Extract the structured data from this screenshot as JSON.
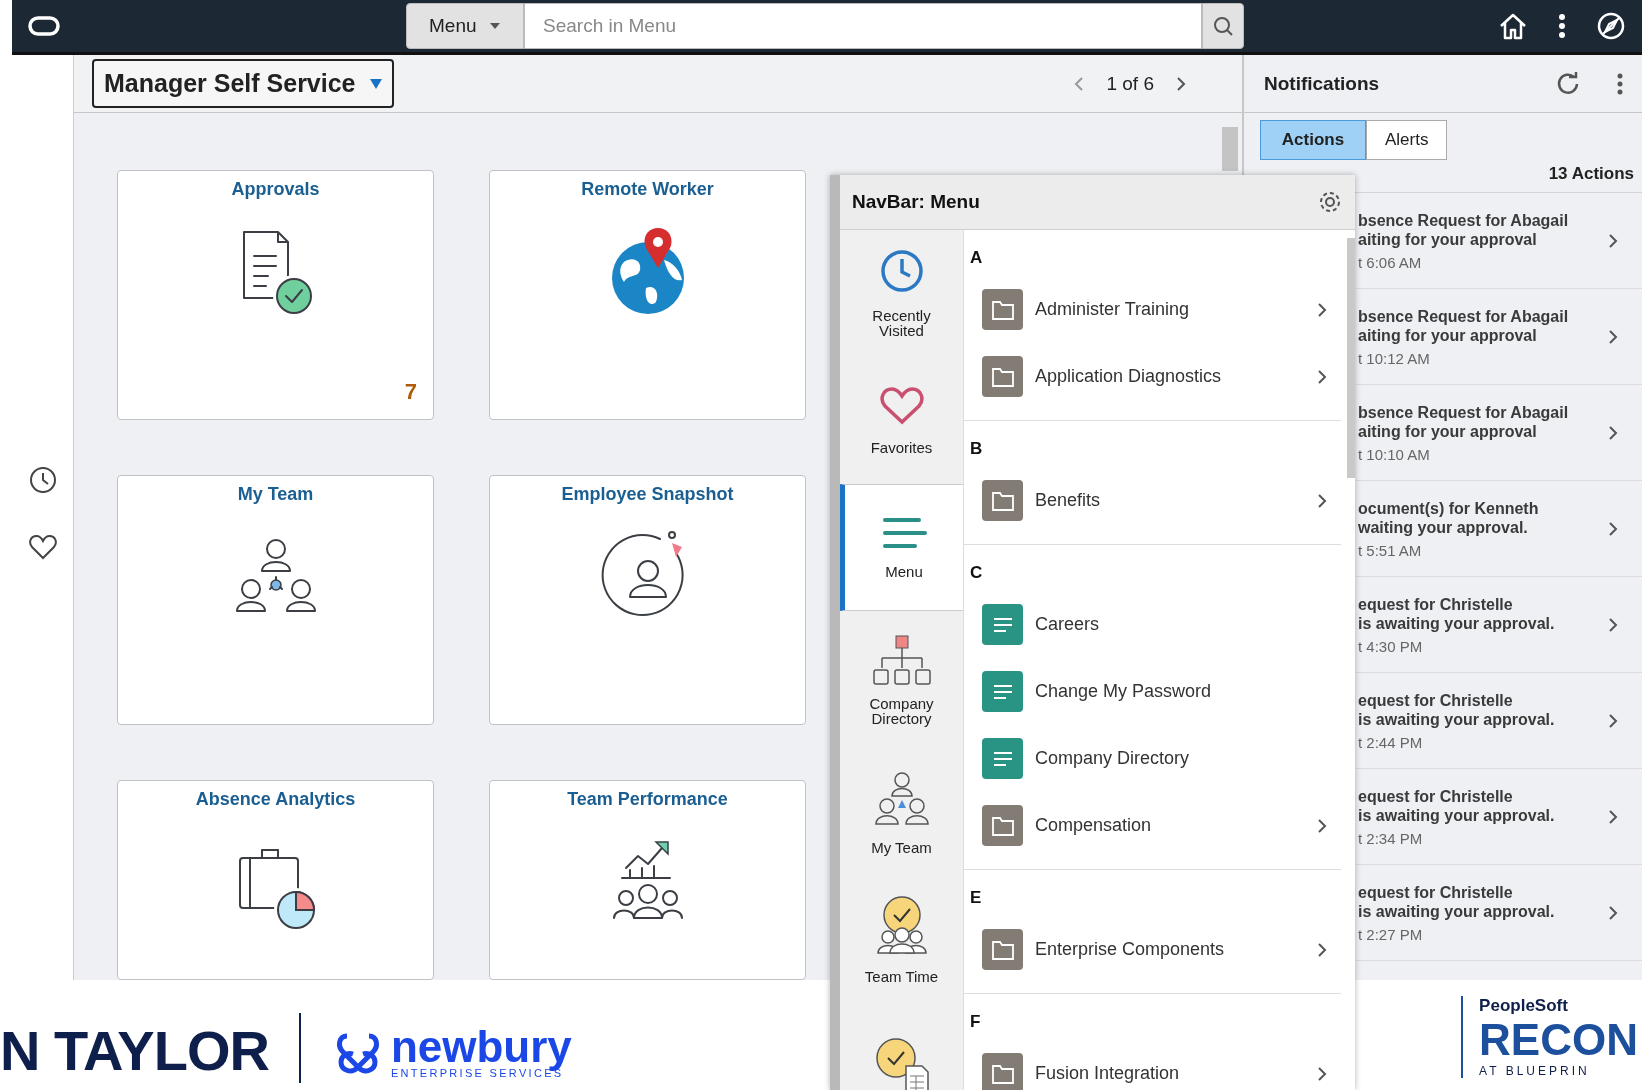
{
  "top_bar": {
    "menu_button": "Menu",
    "search": {
      "placeholder": "Search in Menu"
    }
  },
  "page_header": {
    "title": "Manager Self Service",
    "pager": "1 of 6"
  },
  "tiles": [
    {
      "title": "Approvals",
      "kind": "approvals",
      "badge": "7"
    },
    {
      "title": "Remote Worker",
      "kind": "remote-worker"
    },
    {
      "title": "My Team",
      "kind": "my-team"
    },
    {
      "title": "Employee Snapshot",
      "kind": "employee-snapshot"
    },
    {
      "title": "Absence Analytics",
      "kind": "absence-analytics"
    },
    {
      "title": "Team Performance",
      "kind": "team-performance"
    }
  ],
  "navbar": {
    "title": "NavBar: Menu",
    "sections": [
      {
        "label": "Recently Visited",
        "kind": "recent",
        "selected": false
      },
      {
        "label": "Favorites",
        "kind": "favorites",
        "selected": false
      },
      {
        "label": "Menu",
        "kind": "menu",
        "selected": true
      },
      {
        "label": "Company Directory",
        "kind": "company-directory",
        "selected": false
      },
      {
        "label": "My Team",
        "kind": "my-team",
        "selected": false
      },
      {
        "label": "Team Time",
        "kind": "team-time",
        "selected": false
      },
      {
        "kind": "time-report",
        "selected": false
      }
    ],
    "groups": [
      {
        "letter": "A",
        "items": [
          {
            "label": "Administer Training",
            "kind": "folder"
          },
          {
            "label": "Application Diagnostics",
            "kind": "folder"
          }
        ]
      },
      {
        "letter": "B",
        "items": [
          {
            "label": "Benefits",
            "kind": "folder"
          }
        ]
      },
      {
        "letter": "C",
        "items": [
          {
            "label": "Careers",
            "kind": "page"
          },
          {
            "label": "Change My Password",
            "kind": "page"
          },
          {
            "label": "Company Directory",
            "kind": "page"
          },
          {
            "label": "Compensation",
            "kind": "folder"
          }
        ]
      },
      {
        "letter": "E",
        "items": [
          {
            "label": "Enterprise Components",
            "kind": "folder"
          }
        ]
      },
      {
        "letter": "F",
        "items": [
          {
            "label": "Fusion Integration",
            "kind": "folder"
          }
        ]
      }
    ]
  },
  "notifications": {
    "title": "Notifications",
    "tabs": [
      {
        "label": "Actions",
        "selected": true
      },
      {
        "label": "Alerts",
        "selected": false
      }
    ],
    "count": "13 Actions",
    "items": [
      {
        "line1": "bsence Request for Abagail",
        "line2": "aiting for your approval",
        "time": "t 6:06 AM"
      },
      {
        "line1": "bsence Request for Abagail",
        "line2": "aiting for your approval",
        "time": "t 10:12 AM"
      },
      {
        "line1": "bsence Request for Abagail",
        "line2": "aiting for your approval",
        "time": "t 10:10 AM"
      },
      {
        "line1": "ocument(s) for Kenneth",
        "line2": "waiting your approval.",
        "time": "t 5:51 AM"
      },
      {
        "line1": "equest for Christelle",
        "line2": "is awaiting your approval.",
        "time": "t 4:30 PM"
      },
      {
        "line1": "equest for Christelle",
        "line2": "is awaiting your approval.",
        "time": "t 2:44 PM"
      },
      {
        "line1": "equest for Christelle",
        "line2": "is awaiting your approval.",
        "time": "t 2:34 PM"
      },
      {
        "line1": "equest for Christelle",
        "line2": "is awaiting your approval.",
        "time": "t 2:27 PM"
      }
    ]
  },
  "banner": {
    "left_brand": "N TAYLOR",
    "partner_name": "newbury",
    "partner_tagline": "ENTERPRISE SERVICES",
    "event_brand": "PeopleSoft",
    "event_name": "RECON",
    "event_tagline": "AT BLUEPRIN"
  }
}
